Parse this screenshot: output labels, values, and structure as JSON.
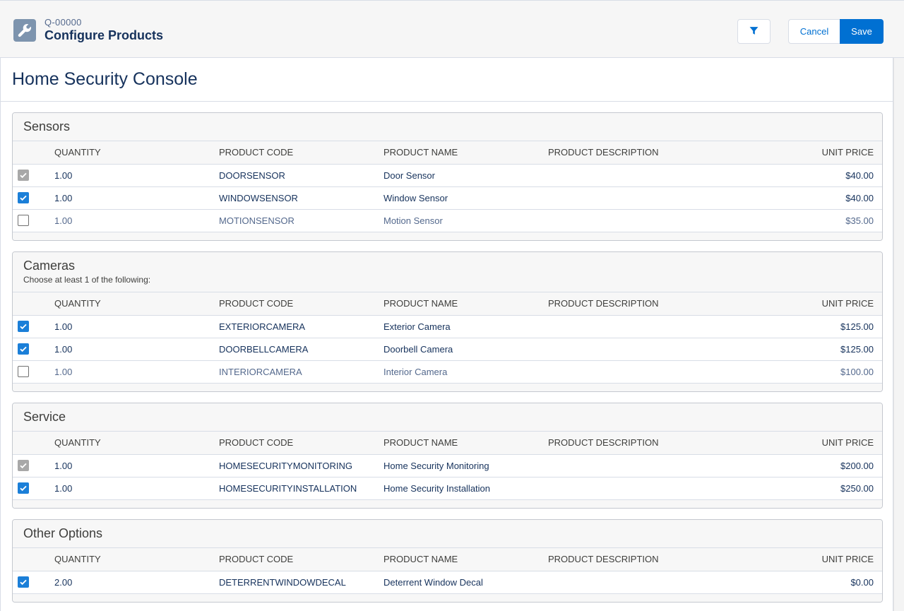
{
  "header": {
    "subtitle": "Q-00000",
    "title": "Configure Products",
    "icon": "wrench-icon",
    "filter_icon": "filter-icon",
    "cancel_label": "Cancel",
    "save_label": "Save"
  },
  "page": {
    "title": "Home Security Console"
  },
  "columns": [
    "",
    "QUANTITY",
    "PRODUCT CODE",
    "PRODUCT NAME",
    "PRODUCT DESCRIPTION",
    "UNIT PRICE"
  ],
  "groups": [
    {
      "title": "Sensors",
      "description": "",
      "rows": [
        {
          "state": "disabled",
          "quantity": "1.00",
          "code": "DOORSENSOR",
          "name": "Door Sensor",
          "description": "",
          "price": "$40.00"
        },
        {
          "state": "checked",
          "quantity": "1.00",
          "code": "WINDOWSENSOR",
          "name": "Window Sensor",
          "description": "",
          "price": "$40.00"
        },
        {
          "state": "empty",
          "quantity": "1.00",
          "code": "MOTIONSENSOR",
          "name": "Motion Sensor",
          "description": "",
          "price": "$35.00"
        }
      ]
    },
    {
      "title": "Cameras",
      "description": "Choose at least 1 of the following:",
      "rows": [
        {
          "state": "checked",
          "quantity": "1.00",
          "code": "EXTERIORCAMERA",
          "name": "Exterior Camera",
          "description": "",
          "price": "$125.00"
        },
        {
          "state": "checked",
          "quantity": "1.00",
          "code": "DOORBELLCAMERA",
          "name": "Doorbell Camera",
          "description": "",
          "price": "$125.00"
        },
        {
          "state": "empty",
          "quantity": "1.00",
          "code": "INTERIORCAMERA",
          "name": "Interior Camera",
          "description": "",
          "price": "$100.00"
        }
      ]
    },
    {
      "title": "Service",
      "description": "",
      "rows": [
        {
          "state": "disabled",
          "quantity": "1.00",
          "code": "HOMESECURITYMONITORING",
          "name": "Home Security Monitoring",
          "description": "",
          "price": "$200.00"
        },
        {
          "state": "checked",
          "quantity": "1.00",
          "code": "HOMESECURITYINSTALLATION",
          "name": "Home Security Installation",
          "description": "",
          "price": "$250.00"
        }
      ]
    },
    {
      "title": "Other Options",
      "description": "",
      "rows": [
        {
          "state": "checked",
          "quantity": "2.00",
          "code": "DETERRENTWINDOWDECAL",
          "name": "Deterrent Window Decal",
          "description": "",
          "price": "$0.00"
        }
      ]
    }
  ]
}
